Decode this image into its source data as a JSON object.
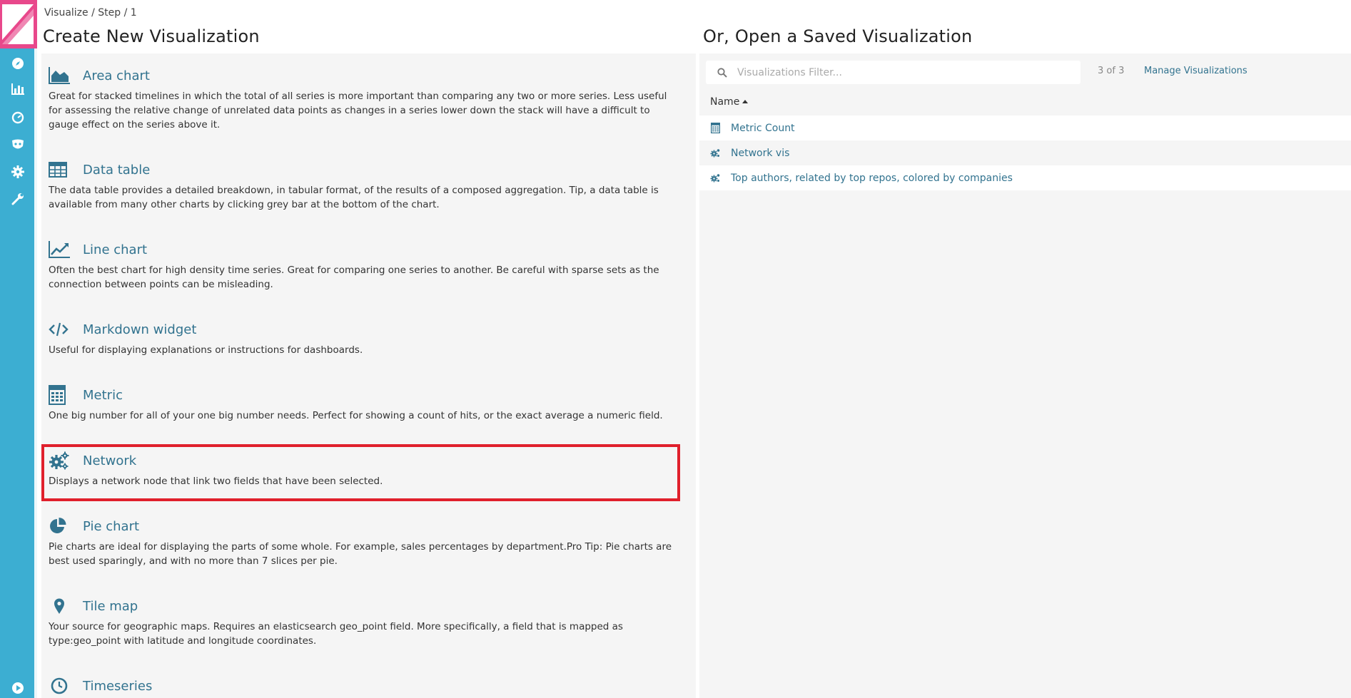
{
  "breadcrumb": "Visualize / Step / 1",
  "left_title": "Create New Visualization",
  "right_title": "Or, Open a Saved Visualization",
  "sidebar": {
    "icons": [
      "compass-icon",
      "bar-chart-icon",
      "dashboard-gauge-icon",
      "timelion-mask-icon",
      "gear-icon",
      "wrench-icon",
      "play-icon"
    ]
  },
  "vis_types": [
    {
      "title": "Area chart",
      "icon": "area-chart-icon",
      "desc": "Great for stacked timelines in which the total of all series is more important than comparing any two or more series. Less useful for assessing the relative change of unrelated data points as changes in a series lower down the stack will have a difficult to gauge effect on the series above it."
    },
    {
      "title": "Data table",
      "icon": "table-icon",
      "desc": "The data table provides a detailed breakdown, in tabular format, of the results of a composed aggregation. Tip, a data table is available from many other charts by clicking grey bar at the bottom of the chart."
    },
    {
      "title": "Line chart",
      "icon": "line-chart-icon",
      "desc": "Often the best chart for high density time series. Great for comparing one series to another. Be careful with sparse sets as the connection between points can be misleading."
    },
    {
      "title": "Markdown widget",
      "icon": "code-icon",
      "desc": "Useful for displaying explanations or instructions for dashboards."
    },
    {
      "title": "Metric",
      "icon": "calculator-icon",
      "desc": "One big number for all of your one big number needs. Perfect for showing a count of hits, or the exact average a numeric field."
    },
    {
      "title": "Network",
      "icon": "gears-icon",
      "desc": "Displays a network node that link two fields that have been selected."
    },
    {
      "title": "Pie chart",
      "icon": "pie-chart-icon",
      "desc": "Pie charts are ideal for displaying the parts of some whole. For example, sales percentages by department.Pro Tip: Pie charts are best used sparingly, and with no more than 7 slices per pie."
    },
    {
      "title": "Tile map",
      "icon": "map-marker-icon",
      "desc": "Your source for geographic maps. Requires an elasticsearch geo_point field. More specifically, a field that is mapped as type:geo_point with latitude and longitude coordinates."
    },
    {
      "title": "Timeseries",
      "icon": "clock-icon",
      "desc": ""
    }
  ],
  "search": {
    "placeholder": "Visualizations Filter...",
    "value": ""
  },
  "count": "3 of 3",
  "manage_label": "Manage Visualizations",
  "column_name": "Name",
  "saved": [
    {
      "label": "Metric Count",
      "icon": "calculator-icon"
    },
    {
      "label": "Network vis",
      "icon": "gears-icon"
    },
    {
      "label": "Top authors, related by top repos, colored by companies",
      "icon": "gears-icon"
    }
  ],
  "colors": {
    "sidebar": "#3caed2",
    "logo": "#e8488b",
    "link": "#32738f",
    "highlight": "#e0202c"
  }
}
